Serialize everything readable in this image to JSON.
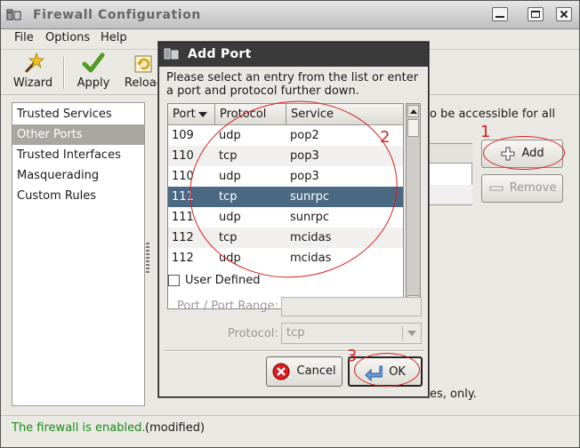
{
  "main_window": {
    "title": "Firewall Configuration",
    "menu": [
      "File",
      "Options",
      "Help"
    ],
    "toolbar": {
      "wizard_label": "Wizard",
      "apply_label": "Apply",
      "reload_label": "Reload"
    },
    "sidebar": {
      "items": [
        {
          "label": "Trusted Services"
        },
        {
          "label": "Other Ports",
          "selected": true
        },
        {
          "label": "Trusted Interfaces"
        },
        {
          "label": "Masquerading"
        },
        {
          "label": "Custom Rules"
        }
      ]
    },
    "description_text": "o be accessible for all",
    "add_button": "Add",
    "remove_button": "Remove",
    "bottom_text": "es, only.",
    "status": {
      "enabled_text": "The firewall is enabled.",
      "modified_text": "(modified)"
    }
  },
  "dialog": {
    "title": "Add Port",
    "instructions": "Please select an entry from the list or enter a port and protocol further down.",
    "columns": [
      "Port",
      "Protocol",
      "Service"
    ],
    "rows": [
      {
        "port": "109",
        "protocol": "udp",
        "service": "pop2"
      },
      {
        "port": "110",
        "protocol": "tcp",
        "service": "pop3"
      },
      {
        "port": "110",
        "protocol": "udp",
        "service": "pop3"
      },
      {
        "port": "111",
        "protocol": "tcp",
        "service": "sunrpc",
        "selected": true
      },
      {
        "port": "111",
        "protocol": "udp",
        "service": "sunrpc"
      },
      {
        "port": "112",
        "protocol": "tcp",
        "service": "mcidas"
      },
      {
        "port": "112",
        "protocol": "udp",
        "service": "mcidas"
      }
    ],
    "user_defined_label": "User Defined",
    "user_defined_checked": false,
    "port_range_label": "Port / Port Range:",
    "port_range_value": "",
    "protocol_label": "Protocol:",
    "protocol_value": "tcp",
    "cancel_button": "Cancel",
    "ok_button": "OK"
  },
  "annotations": {
    "step1": "1",
    "step2": "2",
    "step3": "3",
    "color": "#d42020"
  },
  "colors": {
    "selection": "#4b6983",
    "status_green": "#1a8b1a",
    "dialog_titlebar": "#3a3a3a"
  },
  "icons": {
    "wizard": "magic-wand-icon",
    "apply": "checkmark-icon",
    "reload": "reload-icon",
    "add": "plus-icon",
    "remove": "minus-icon",
    "cancel": "cancel-icon",
    "ok": "ok-arrow-icon"
  }
}
